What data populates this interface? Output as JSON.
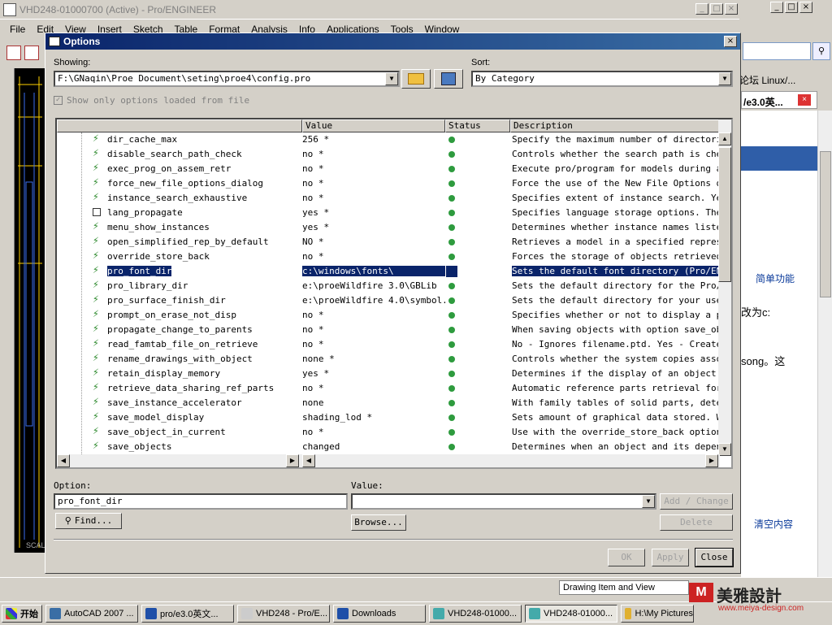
{
  "proe_window": {
    "title": "VHD248-01000700 (Active) - Pro/ENGINEER",
    "menu": [
      "File",
      "Edit",
      "View",
      "Insert",
      "Sketch",
      "Table",
      "Format",
      "Analysis",
      "Info",
      "Applications",
      "Tools",
      "Window"
    ],
    "filter_value": "Drawing Item and View",
    "cad_label": "SCAL"
  },
  "browser": {
    "tab_label": "/e3.0英...",
    "text_1": "论坛 Linux/...",
    "text_2": "简单功能",
    "text_3": "改为c:",
    "text_4": "song。这",
    "text_5": "清空内容"
  },
  "dialog": {
    "title": "Options",
    "showing_label": "Showing:",
    "showing_value": "F:\\GNaqin\\Proe Document\\seting\\proe4\\config.pro",
    "sort_label": "Sort:",
    "sort_value": "By Category",
    "show_only_label": "Show only options loaded from file",
    "columns": [
      "Value",
      "Status",
      "Description"
    ],
    "rows": [
      {
        "name": "dir_cache_max",
        "value": "256 *",
        "desc": "Specify the maximum number of directories t",
        "icon": "lightning"
      },
      {
        "name": "disable_search_path_check",
        "value": "no *",
        "desc": "Controls whether the search path is checked",
        "icon": "lightning"
      },
      {
        "name": "exec_prog_on_assem_retr",
        "value": "no *",
        "desc": "Execute pro/program for models during assem",
        "icon": "lightning"
      },
      {
        "name": "force_new_file_options_dialog",
        "value": "no *",
        "desc": "Force the use of the New File Options dialo",
        "icon": "lightning"
      },
      {
        "name": "instance_search_exhaustive",
        "value": "no *",
        "desc": "Specifies extent of instance search. Yes -",
        "icon": "lightning"
      },
      {
        "name": "lang_propagate",
        "value": "yes *",
        "desc": "Specifies language storage options. The opt",
        "icon": "box"
      },
      {
        "name": "menu_show_instances",
        "value": "yes *",
        "desc": "Determines whether instance names listed in",
        "icon": "lightning"
      },
      {
        "name": "open_simplified_rep_by_default",
        "value": "NO *",
        "desc": "Retrieves a model in a specified representa",
        "icon": "lightning"
      },
      {
        "name": "override_store_back",
        "value": "no *",
        "desc": "Forces the storage of objects retrieved fro",
        "icon": "lightning"
      },
      {
        "name": "pro_font_dir",
        "value": "c:\\windows\\fonts\\",
        "desc": "Sets the default font directory (Pro/ENGINE",
        "icon": "lightning",
        "selected": true
      },
      {
        "name": "pro_library_dir",
        "value": "e:\\proeWildfire 3.0\\GBLib",
        "desc": "Sets the default directory for the Pro/ENGI",
        "icon": "lightning"
      },
      {
        "name": "pro_surface_finish_dir",
        "value": "e:\\proeWildfire 4.0\\symbol...",
        "desc": "Sets the default directory for your user-de",
        "icon": "lightning"
      },
      {
        "name": "prompt_on_erase_not_disp",
        "value": "no *",
        "desc": "Specifies whether or not to display a promp",
        "icon": "lightning"
      },
      {
        "name": "propagate_change_to_parents",
        "value": "no *",
        "desc": "When saving objects with option save_object",
        "icon": "lightning"
      },
      {
        "name": "read_famtab_file_on_retrieve",
        "value": "no *",
        "desc": "No - Ignores filename.ptd. Yes - Creates an",
        "icon": "lightning"
      },
      {
        "name": "rename_drawings_with_object",
        "value": "none *",
        "desc": "Controls whether the system copies associat",
        "icon": "lightning"
      },
      {
        "name": "retain_display_memory",
        "value": "yes *",
        "desc": "Determines if the display of an object curr",
        "icon": "lightning"
      },
      {
        "name": "retrieve_data_sharing_ref_parts",
        "value": "no *",
        "desc": "Automatic reference parts retrieval for dep",
        "icon": "lightning"
      },
      {
        "name": "save_instance_accelerator",
        "value": "none",
        "desc": "With family tables of solid parts, determin",
        "icon": "lightning"
      },
      {
        "name": "save_model_display",
        "value": "shading_lod *",
        "desc": "Sets amount of graphical data stored. Wiref",
        "icon": "lightning"
      },
      {
        "name": "save_object_in_current",
        "value": "no *",
        "desc": "Use with the override_store_back option. Ye",
        "icon": "lightning"
      },
      {
        "name": "save_objects",
        "value": "changed",
        "desc": "Determines when an object and its dependent",
        "icon": "lightning"
      }
    ],
    "option_label": "Option:",
    "option_value": "pro_font_dir",
    "value_label": "Value:",
    "value_value": "",
    "add_change": "Add / Change",
    "find": "Find...",
    "browse": "Browse...",
    "delete": "Delete",
    "ok": "OK",
    "apply": "Apply",
    "close": "Close"
  },
  "taskbar": {
    "start": "开始",
    "items": [
      {
        "label": "AutoCAD 2007 ...",
        "color": "#3a6ea5"
      },
      {
        "label": "pro/e3.0英文...",
        "color": "#1f4fa8"
      },
      {
        "label": "VHD248 - Pro/E...",
        "color": "#ccc"
      },
      {
        "label": "Downloads",
        "color": "#1f4fa8"
      },
      {
        "label": "VHD248-01000...",
        "color": "#4aa"
      },
      {
        "label": "VHD248-01000...",
        "color": "#4aa",
        "active": true
      },
      {
        "label": "H:\\My Pictures",
        "color": "#e0b030"
      }
    ],
    "watermark_cn": "美雅設計",
    "watermark_url": "www.meiya-design.com"
  }
}
